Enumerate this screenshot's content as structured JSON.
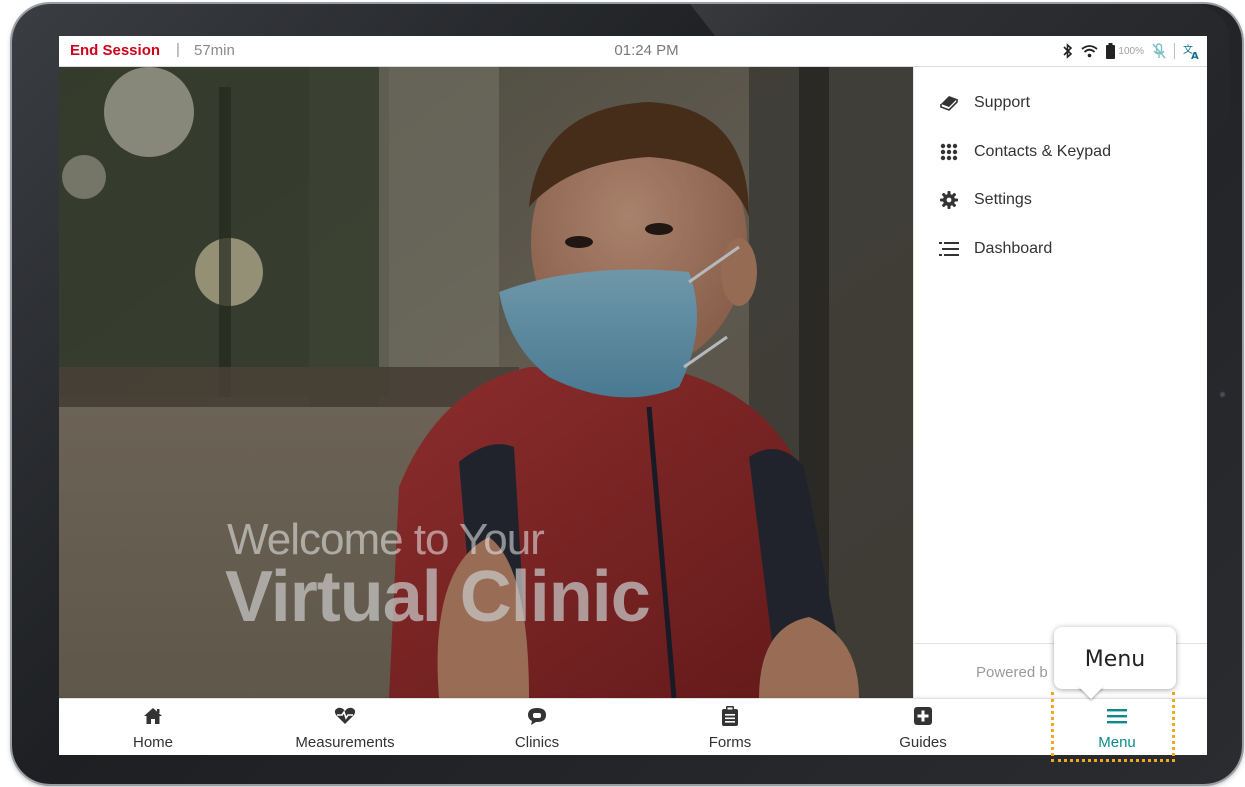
{
  "status_bar": {
    "end_session_label": "End Session",
    "separator": "|",
    "duration": "57min",
    "time": "01:24 PM",
    "battery_percent": "100%",
    "icons": [
      "bluetooth-icon",
      "wifi-icon",
      "battery-icon",
      "mic-muted-icon",
      "translate-icon"
    ]
  },
  "hero": {
    "welcome_line1": "Welcome to Your",
    "welcome_line2": "Virtual Clinic"
  },
  "side_menu": {
    "items": [
      {
        "label": "Support",
        "icon": "support-icon"
      },
      {
        "label": "Contacts & Keypad",
        "icon": "keypad-icon"
      },
      {
        "label": "Settings",
        "icon": "gear-icon"
      },
      {
        "label": "Dashboard",
        "icon": "dashboard-icon"
      }
    ],
    "powered_by": "Powered b"
  },
  "bottom_nav": {
    "items": [
      {
        "label": "Home",
        "icon": "home-icon"
      },
      {
        "label": "Measurements",
        "icon": "heart-pulse-icon"
      },
      {
        "label": "Clinics",
        "icon": "chat-icon"
      },
      {
        "label": "Forms",
        "icon": "clipboard-icon"
      },
      {
        "label": "Guides",
        "icon": "plus-square-icon"
      },
      {
        "label": "Menu",
        "icon": "hamburger-icon"
      }
    ],
    "active": "Menu"
  },
  "tooltip": {
    "text": "Menu"
  },
  "colors": {
    "end_session": "#d0021b",
    "accent": "#0e8a8c",
    "highlight": "#f5a623"
  }
}
